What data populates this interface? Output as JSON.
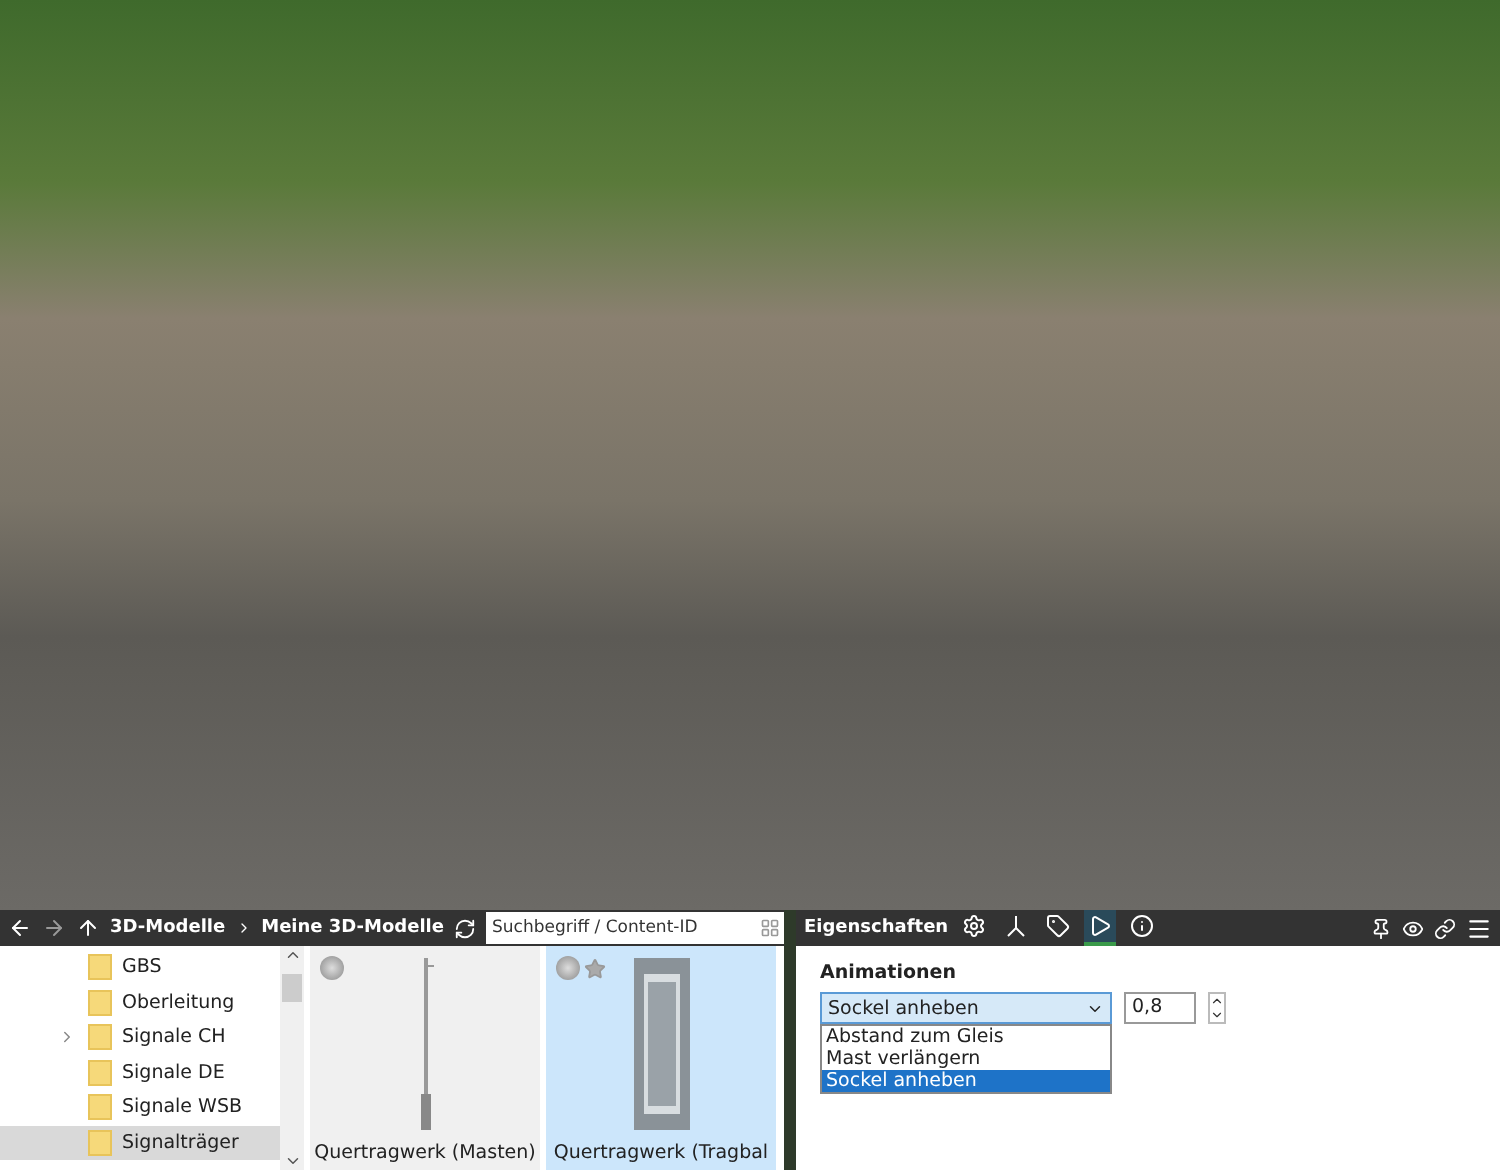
{
  "browser": {
    "crumbs": [
      "3D-Modelle",
      "Meine 3D-Modelle"
    ],
    "search": {
      "placeholder": "Suchbegriff / Content-ID"
    },
    "tree": [
      {
        "label": "GBS",
        "expandable": false,
        "selected": false
      },
      {
        "label": "Oberleitung",
        "expandable": false,
        "selected": false
      },
      {
        "label": "Signale CH",
        "expandable": true,
        "selected": false
      },
      {
        "label": "Signale DE",
        "expandable": false,
        "selected": false
      },
      {
        "label": "Signale WSB",
        "expandable": false,
        "selected": false
      },
      {
        "label": "Signalträger",
        "expandable": false,
        "selected": true
      }
    ],
    "models": [
      {
        "caption": "Quertragwerk (Masten)",
        "kind": "mast",
        "selected": false,
        "show_star": false
      },
      {
        "caption": "Quertragwerk (Tragbal",
        "kind": "frame",
        "selected": true,
        "show_star": true
      }
    ]
  },
  "properties": {
    "title": "Eigenschaften",
    "tools": [
      {
        "kind": "gear",
        "selected": false
      },
      {
        "kind": "axes",
        "selected": false
      },
      {
        "kind": "tag",
        "selected": false
      },
      {
        "kind": "play",
        "selected": true
      },
      {
        "kind": "info",
        "selected": false
      }
    ],
    "section": "Animationen",
    "select": {
      "value": "Sockel anheben",
      "options": [
        {
          "label": "Abstand zum Gleis",
          "selected": false
        },
        {
          "label": "Mast verlängern",
          "selected": false
        },
        {
          "label": "Sockel anheben",
          "selected": true
        }
      ]
    },
    "number": {
      "value": "0,8"
    }
  }
}
